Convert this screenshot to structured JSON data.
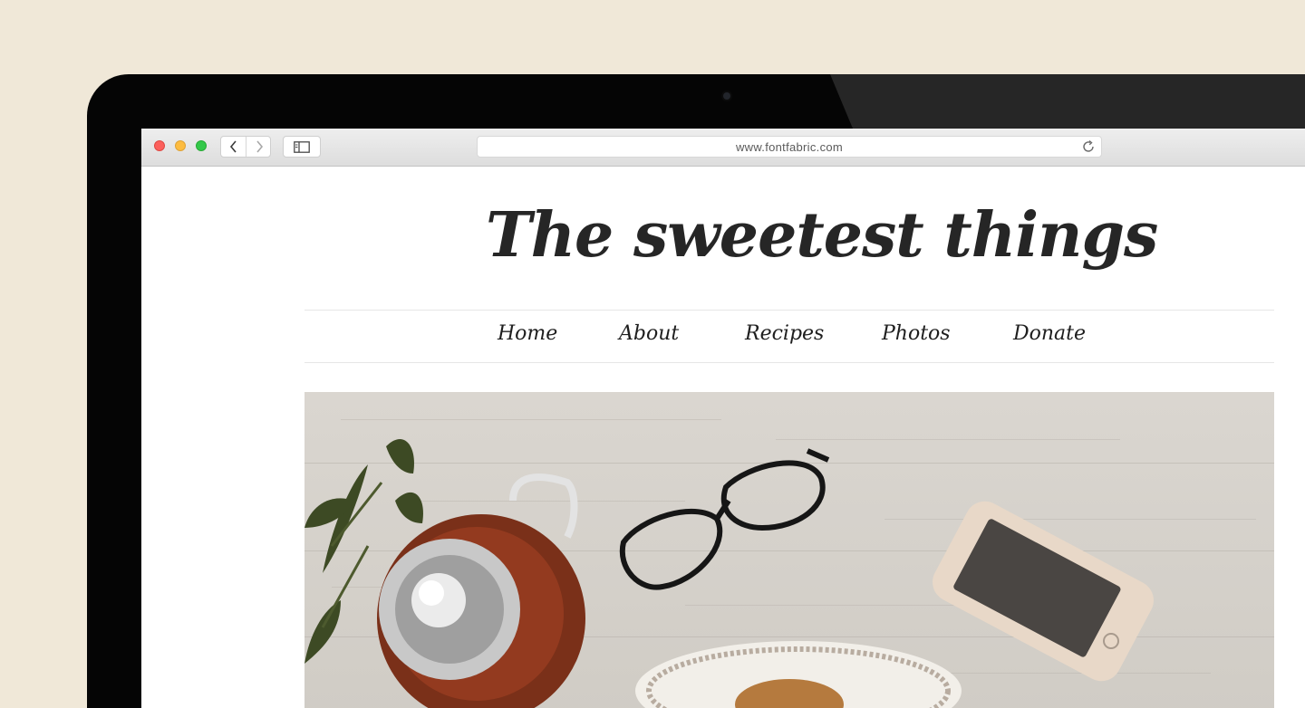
{
  "browser": {
    "url": "www.fontfabric.com"
  },
  "site": {
    "title": "The sweetest things",
    "nav": [
      "Home",
      "About",
      "Recipes",
      "Photos",
      "Donate"
    ]
  },
  "colors": {
    "background": "#f0e8d8",
    "bezel": "#050505",
    "text": "#262626"
  },
  "icons": {
    "back": "chevron-left-icon",
    "forward": "chevron-right-icon",
    "sidebar": "sidebar-icon",
    "reload": "reload-icon"
  }
}
